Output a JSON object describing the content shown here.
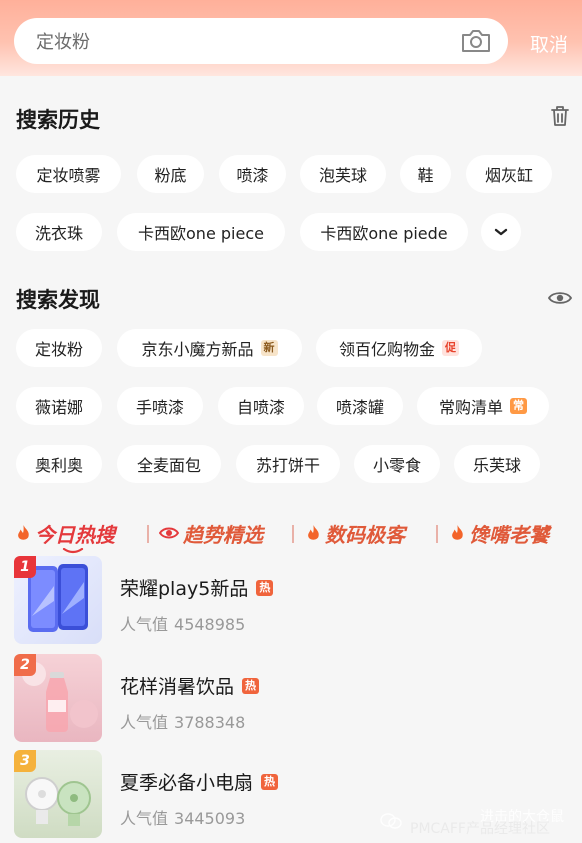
{
  "search": {
    "placeholder": "定妆粉",
    "cancel_label": "取消"
  },
  "history": {
    "title": "搜索历史",
    "items": [
      "定妆喷雾",
      "粉底",
      "喷漆",
      "泡芙球",
      "鞋",
      "烟灰缸",
      "洗衣珠",
      "卡西欧one piece",
      "卡西欧one piede"
    ]
  },
  "discover": {
    "title": "搜索发现",
    "items": [
      {
        "label": "定妆粉",
        "badge": ""
      },
      {
        "label": "京东小魔方新品",
        "badge": "新"
      },
      {
        "label": "领百亿购物金",
        "badge": "促"
      },
      {
        "label": "薇诺娜",
        "badge": ""
      },
      {
        "label": "手喷漆",
        "badge": ""
      },
      {
        "label": "自喷漆",
        "badge": ""
      },
      {
        "label": "喷漆罐",
        "badge": ""
      },
      {
        "label": "常购清单",
        "badge": "常"
      },
      {
        "label": "奥利奥",
        "badge": ""
      },
      {
        "label": "全麦面包",
        "badge": ""
      },
      {
        "label": "苏打饼干",
        "badge": ""
      },
      {
        "label": "小零食",
        "badge": ""
      },
      {
        "label": "乐芙球",
        "badge": ""
      }
    ]
  },
  "tabs": [
    "今日热搜",
    "趋势精选",
    "数码极客",
    "馋嘴老饕"
  ],
  "ranking": {
    "popularity_label": "人气值",
    "hot_badge": "热",
    "items": [
      {
        "rank": "1",
        "name": "荣耀play5新品",
        "popularity": "4548985"
      },
      {
        "rank": "2",
        "name": "花样消暑饮品",
        "popularity": "3788348"
      },
      {
        "rank": "3",
        "name": "夏季必备小电扇",
        "popularity": "3445093"
      }
    ]
  },
  "watermark": {
    "name": "进击的大仓鼠",
    "sub": "PMCAFF产品经理社区"
  },
  "colors": {
    "accent": "#e4393c",
    "header": "#ffb09a"
  }
}
